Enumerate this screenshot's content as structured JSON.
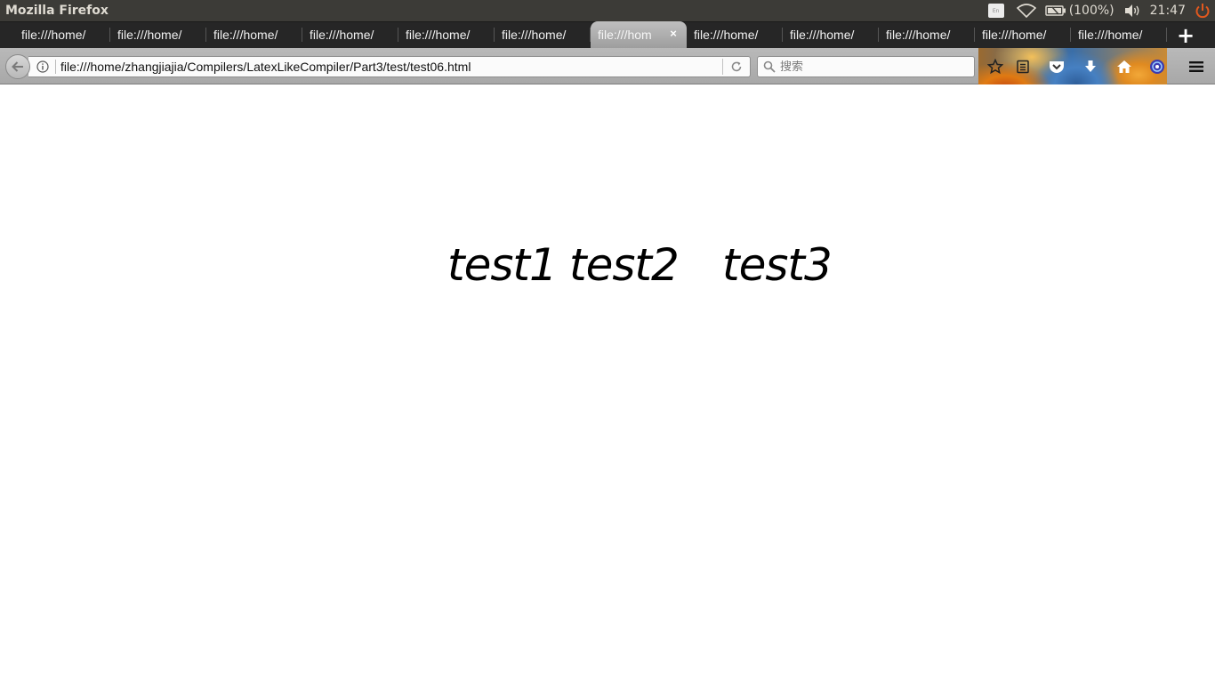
{
  "top_panel": {
    "app_title": "Mozilla Firefox",
    "battery_text": "(100%)",
    "clock": "21:47",
    "keyboard_indicator": "En"
  },
  "tabs": [
    {
      "label": "file:///home/"
    },
    {
      "label": "file:///home/"
    },
    {
      "label": "file:///home/"
    },
    {
      "label": "file:///home/"
    },
    {
      "label": "file:///home/"
    },
    {
      "label": "file:///home/"
    },
    {
      "label": "file:///hom",
      "active": true
    },
    {
      "label": "file:///home/"
    },
    {
      "label": "file:///home/"
    },
    {
      "label": "file:///home/"
    },
    {
      "label": "file:///home/"
    },
    {
      "label": "file:///home/"
    }
  ],
  "new_tab_label": "+",
  "close_tab_label": "×",
  "nav": {
    "url": "file:///home/zhangjiajia/Compilers/LatexLikeCompiler/Part3/test/test06.html",
    "search_placeholder": "搜索"
  },
  "icons": {
    "back": "back-arrow-icon",
    "info": "info-icon",
    "reload": "reload-icon",
    "search": "search-icon",
    "bookmark": "star-icon",
    "reading_list": "reading-list-icon",
    "pocket": "pocket-icon",
    "downloads": "download-icon",
    "home": "home-icon",
    "extension": "extension-icon",
    "menu": "hamburger-menu-icon"
  },
  "content": {
    "words": [
      "test1",
      "test2",
      "test3"
    ]
  },
  "colors": {
    "panel_bg": "#3c3b37",
    "tabbar_bg": "#262626",
    "page_bg": "#ffffff",
    "text": "#000000",
    "power_icon": "#e2581e"
  }
}
